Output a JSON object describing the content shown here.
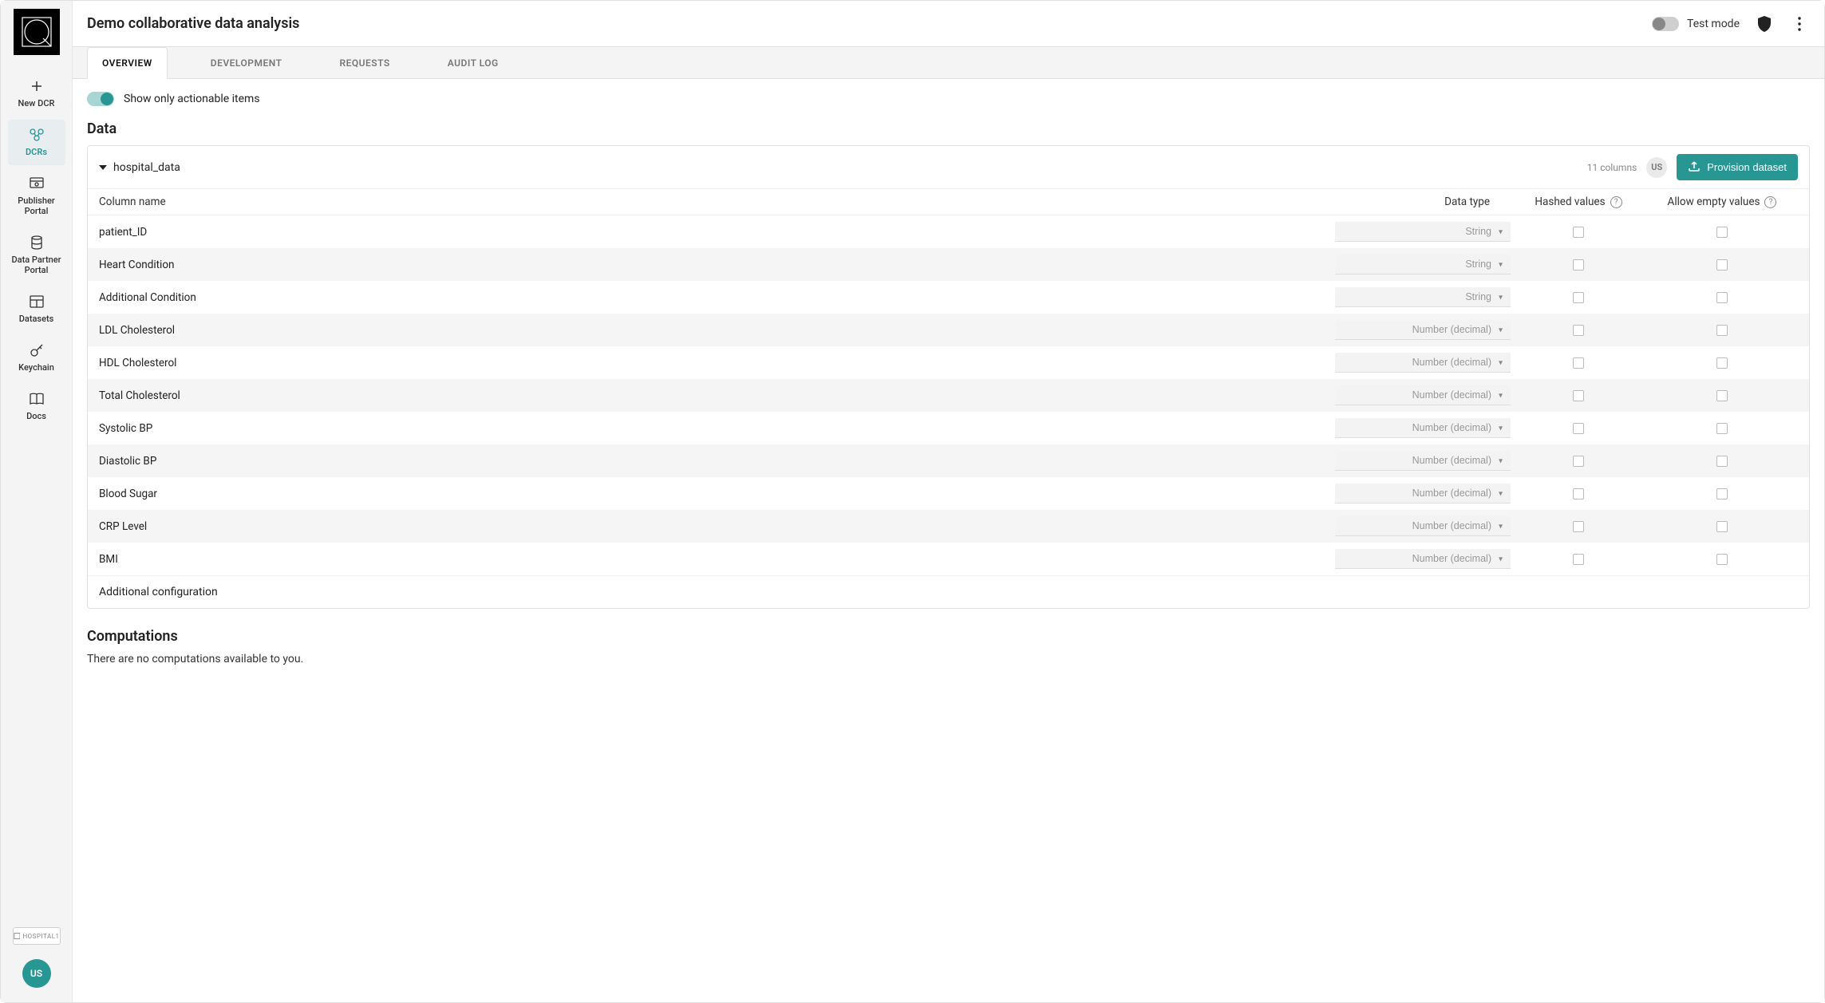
{
  "sidebar": {
    "items": [
      {
        "label": "New DCR",
        "icon": "plus"
      },
      {
        "label": "DCRs",
        "icon": "dcr",
        "active": true
      },
      {
        "label": "Publisher Portal",
        "icon": "portal"
      },
      {
        "label": "Data Partner Portal",
        "icon": "db"
      },
      {
        "label": "Datasets",
        "icon": "table"
      },
      {
        "label": "Keychain",
        "icon": "key"
      },
      {
        "label": "Docs",
        "icon": "book"
      }
    ],
    "hospital_badge": "HOSPITAL1",
    "avatar": "US"
  },
  "header": {
    "title": "Demo collaborative data analysis",
    "test_mode_label": "Test mode",
    "test_mode_on": false
  },
  "tabs": [
    {
      "label": "OVERVIEW",
      "active": true
    },
    {
      "label": "DEVELOPMENT"
    },
    {
      "label": "REQUESTS"
    },
    {
      "label": "AUDIT LOG"
    }
  ],
  "filter": {
    "label": "Show only actionable items",
    "on": true
  },
  "data_section": {
    "title": "Data",
    "dataset_name": "hospital_data",
    "column_count_label": "11 columns",
    "user_chip": "US",
    "provision_button": "Provision dataset",
    "table_headers": {
      "name": "Column name",
      "type": "Data type",
      "hashed": "Hashed values",
      "empty": "Allow empty values"
    },
    "columns": [
      {
        "name": "patient_ID",
        "type": "String"
      },
      {
        "name": "Heart Condition",
        "type": "String"
      },
      {
        "name": "Additional Condition",
        "type": "String"
      },
      {
        "name": "LDL Cholesterol",
        "type": "Number (decimal)"
      },
      {
        "name": "HDL Cholesterol",
        "type": "Number (decimal)"
      },
      {
        "name": "Total Cholesterol",
        "type": "Number (decimal)"
      },
      {
        "name": "Systolic BP",
        "type": "Number (decimal)"
      },
      {
        "name": "Diastolic BP",
        "type": "Number (decimal)"
      },
      {
        "name": "Blood Sugar",
        "type": "Number (decimal)"
      },
      {
        "name": "CRP Level",
        "type": "Number (decimal)"
      },
      {
        "name": "BMI",
        "type": "Number (decimal)"
      }
    ],
    "additional_config": "Additional configuration"
  },
  "computations": {
    "title": "Computations",
    "empty_text": "There are no computations available to you."
  }
}
